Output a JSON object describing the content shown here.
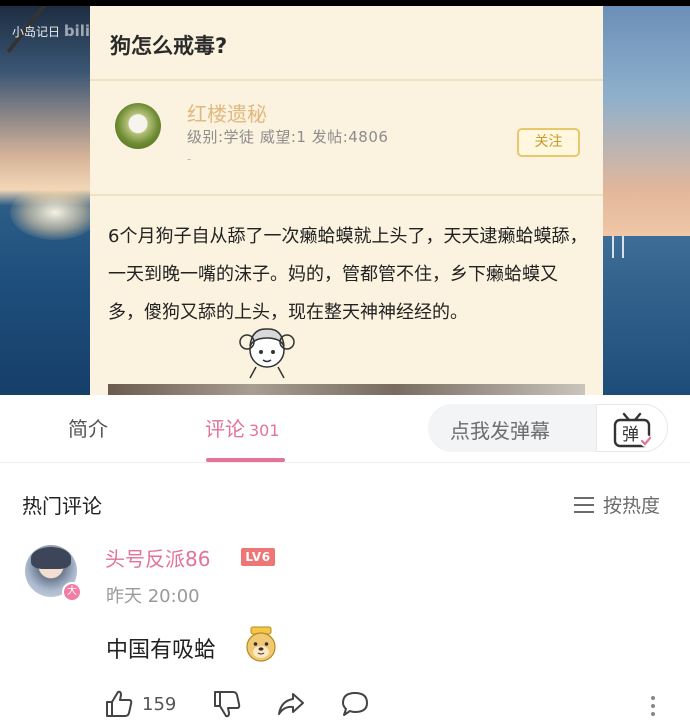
{
  "video": {
    "watermark_text": "小岛记日",
    "watermark_logo": "bili",
    "post": {
      "title": "狗怎么戒毒?",
      "author": {
        "name": "红楼遗秘",
        "meta": "级别:学徒 威望:1 发帖:4806",
        "dot": "-",
        "follow_label": "关注"
      },
      "body": "6个月狗子自从舔了一次癞蛤蟆就上头了，天天逮癞蛤蟆舔，一天到晚一嘴的沫子。妈的，管都管不住，乡下癞蛤蟆又多，傻狗又舔的上头，现在整天神神经经的。"
    }
  },
  "tabs": {
    "intro_label": "简介",
    "comments_label": "评论",
    "comments_count": "301",
    "danmaku_placeholder": "点我发弹幕",
    "danmaku_button_icon": "danmaku-tv-icon",
    "danmaku_button_char": "弹"
  },
  "hot_comments": {
    "title": "热门评论",
    "sort_label": "按热度",
    "sort_icon": "menu-lines-icon"
  },
  "comment": {
    "username": "头号反派86",
    "level_badge": "LV6",
    "badge_char": "大",
    "time": "昨天 20:00",
    "text": "中国有吸蛤",
    "emoji": "doge-emoji",
    "likes": "159"
  },
  "colors": {
    "accent_pink": "#e3739b",
    "card_bg": "#fbf3df",
    "follow_gold": "#e9c76c",
    "level_red": "#ef7676"
  }
}
